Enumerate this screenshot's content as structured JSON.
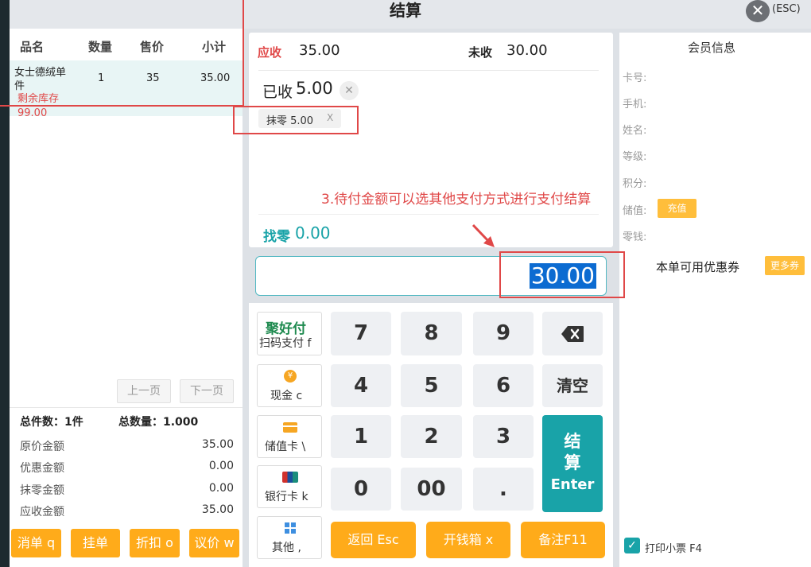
{
  "window": {
    "title": "结算",
    "close_label": "(ESC)"
  },
  "order": {
    "headers": [
      "品名",
      "数量",
      "售价",
      "小计"
    ],
    "items": [
      {
        "name_line1": "女士德绒单",
        "name_line2": "件",
        "qty": "1",
        "price": "35",
        "subtotal": "35.00",
        "stock_label": "剩余库存",
        "stock_value": "99.00"
      }
    ],
    "prev_page": "上一页",
    "next_page": "下一页"
  },
  "summary": {
    "total_items": "总件数：1件",
    "total_qty": "总数量：1.000",
    "rows": [
      {
        "label": "原价金额",
        "value": "35.00"
      },
      {
        "label": "优惠金额",
        "value": "0.00"
      },
      {
        "label": "抹零金额",
        "value": "0.00"
      },
      {
        "label": "应收金额",
        "value": "35.00"
      }
    ]
  },
  "left_actions": [
    "消单 q",
    "挂单",
    "折扣 o",
    "议价 w"
  ],
  "payment": {
    "receivable_label": "应收",
    "receivable_value": "35.00",
    "unpaid_label": "未收",
    "unpaid_value": "30.00",
    "paid_label": "已收",
    "paid_value": "5.00",
    "rounding_tag": "抹零 5.00",
    "rounding_tag_close": "X",
    "change_label": "找零",
    "change_value": "0.00",
    "input_value": "30.00"
  },
  "pay_methods": [
    {
      "brand": "聚好付",
      "label": "扫码支付 f"
    },
    {
      "label": "现金 c"
    },
    {
      "label": "储值卡 \\"
    },
    {
      "label": "银行卡 k"
    },
    {
      "label": "其他 ,"
    }
  ],
  "keypad": {
    "keys": [
      "7",
      "8",
      "9",
      "4",
      "5",
      "6",
      "1",
      "2",
      "3",
      "0",
      "00",
      "."
    ],
    "clear": "清空",
    "settle_line1": "结",
    "settle_line2": "算",
    "settle_line3": "Enter",
    "back": "返回 Esc",
    "cash_drawer": "开钱箱 x",
    "note": "备注F11"
  },
  "member": {
    "title": "会员信息",
    "fields": [
      "卡号:",
      "手机:",
      "姓名:",
      "等级:",
      "积分:",
      "储值:",
      "零钱:"
    ],
    "recharge": "充值",
    "coupon_label": "本单可用优惠券",
    "coupon_more": "更多券",
    "print_receipt": "打印小票 F4"
  },
  "annotation": {
    "text": "3.待付金额可以选其他支付方式进行支付结算"
  },
  "colors": {
    "accent_teal": "#19a3a8",
    "orange": "#ffab1a",
    "red": "#e04848"
  }
}
